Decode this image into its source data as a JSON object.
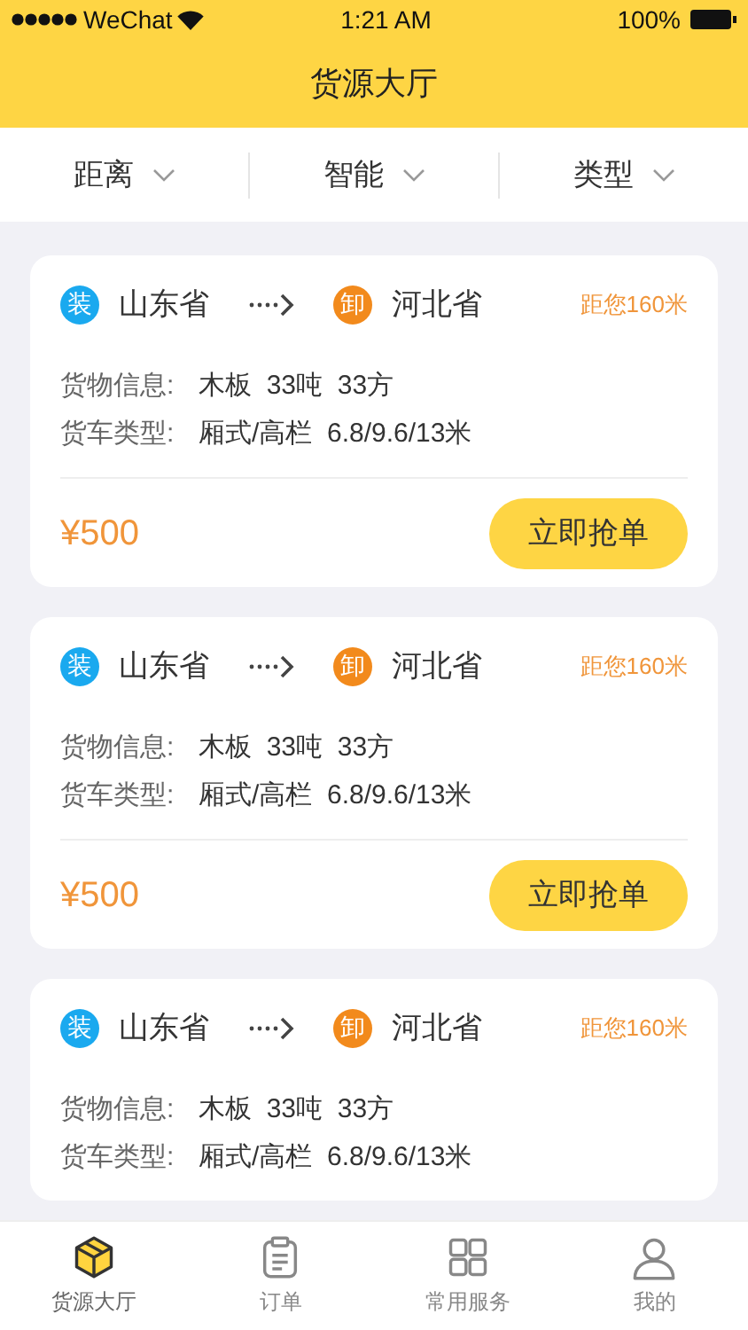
{
  "status_bar": {
    "carrier": "WeChat",
    "time": "1:21 AM",
    "battery": "100%"
  },
  "header": {
    "title": "货源大厅"
  },
  "filters": [
    {
      "label": "距离"
    },
    {
      "label": "智能"
    },
    {
      "label": "类型"
    }
  ],
  "cards": [
    {
      "load_badge": "装",
      "from": "山东省",
      "unload_badge": "卸",
      "to": "河北省",
      "distance": "距您160米",
      "cargo_label": "货物信息:",
      "cargo": "木板  33吨  33方",
      "truck_label": "货车类型:",
      "truck": "厢式/高栏  6.8/9.6/13米",
      "price": "¥500",
      "action": "立即抢单"
    },
    {
      "load_badge": "装",
      "from": "山东省",
      "unload_badge": "卸",
      "to": "河北省",
      "distance": "距您160米",
      "cargo_label": "货物信息:",
      "cargo": "木板  33吨  33方",
      "truck_label": "货车类型:",
      "truck": "厢式/高栏  6.8/9.6/13米",
      "price": "¥500",
      "action": "立即抢单"
    },
    {
      "load_badge": "装",
      "from": "山东省",
      "unload_badge": "卸",
      "to": "河北省",
      "distance": "距您160米",
      "cargo_label": "货物信息:",
      "cargo": "木板  33吨  33方",
      "truck_label": "货车类型:",
      "truck": "厢式/高栏  6.8/9.6/13米"
    }
  ],
  "tab_bar": [
    {
      "label": "货源大厅",
      "kind": "box",
      "selected": true
    },
    {
      "label": "订单",
      "kind": "clipboard",
      "selected": false
    },
    {
      "label": "常用服务",
      "kind": "grid",
      "selected": false
    },
    {
      "label": "我的",
      "kind": "person",
      "selected": false
    }
  ]
}
